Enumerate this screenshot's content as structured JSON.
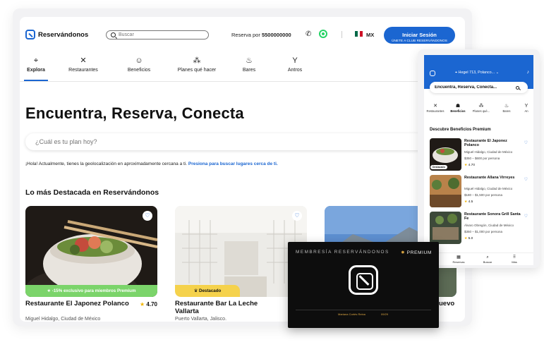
{
  "header": {
    "logo_text": "Reservándonos",
    "search_placeholder": "Buscar",
    "reserve_label": "Reserva por",
    "reserve_phone": "5500000000",
    "country": "MX",
    "login_title": "Iniciar Sesión",
    "login_subtitle": "ÚNETE A CLUB RESERVÁNDONOS"
  },
  "nav": [
    {
      "label": "Explora",
      "icon": "map-pin-icon"
    },
    {
      "label": "Restaurantes",
      "icon": "utensils-icon"
    },
    {
      "label": "Beneficios",
      "icon": "gift-icon"
    },
    {
      "label": "Planes qué hacer",
      "icon": "activities-icon"
    },
    {
      "label": "Bares",
      "icon": "beer-icon"
    },
    {
      "label": "Antros",
      "icon": "cocktail-icon"
    }
  ],
  "hero": {
    "title": "Encuentra, Reserva, Conecta",
    "plan_placeholder": "¿Cuál es tu plan hoy?",
    "geo_text": "¡Hola! Actualmente, tienes la geolocalización en aproximadamente cercana a ti.",
    "geo_link": "Presiona para buscar lugares cerca de ti."
  },
  "featured": {
    "title": "Lo más Destacada en Reservándonos",
    "cards": [
      {
        "tag": "★ -15% exclusivo para miembros Premium",
        "name": "Restaurante El Japonez Polanco",
        "rating": "4.70",
        "address": "Miguel Hidalgo, Ciudad de México"
      },
      {
        "tag": "Destacado",
        "name": "Restaurante Bar La Leche Vallarta",
        "rating": "",
        "address": "Puerto Vallarta, Jalisco."
      },
      {
        "tag": "",
        "name": "uevo",
        "rating": "",
        "address": ""
      }
    ]
  },
  "membership": {
    "title": "MEMBRESÍA RESERVÁNDONOS",
    "tier": "PREMIUM",
    "holder": "Mariana Cortés Reina",
    "expiry": "09/29"
  },
  "mobile": {
    "location": "Hegel 713, Polanco...",
    "search_value": "Encuentra, Reserva, Conecta...",
    "tabs": [
      {
        "label": "Restaurantes",
        "icon": "utensils-icon"
      },
      {
        "label": "Beneficios",
        "icon": "gift-icon"
      },
      {
        "label": "Planes qué...",
        "icon": "activities-icon"
      },
      {
        "label": "Bares",
        "icon": "beer-icon"
      },
      {
        "label": "An",
        "icon": "cocktail-icon"
      }
    ],
    "section_title": "Descubre Beneficios Premium",
    "items": [
      {
        "name": "Restaurante El Japonez Polanco",
        "address": "Miguel Hidalgo, Ciudad de México",
        "price": "$350 – $600 por persona",
        "rating": "4.70",
        "badge": "Destacado"
      },
      {
        "name": "Restaurante Allana Virreyes",
        "address": "Miguel Hidalgo, Ciudad de México",
        "price": "$180 – $1,500 por persona",
        "rating": "4.5",
        "badge": ""
      },
      {
        "name": "Restaurante Sonora Grill Santa Fe",
        "address": "Álvaro Obregón, Ciudad de México",
        "price": "$350 – $1,000 por persona",
        "rating": "5.0",
        "badge": ""
      }
    ],
    "bottom": [
      {
        "label": "Reservas",
        "icon": "calendar-icon"
      },
      {
        "label": "Buscar",
        "icon": "search-icon"
      },
      {
        "label": "Más",
        "icon": "grid-icon"
      }
    ]
  },
  "colors": {
    "brand": "#1b66d1",
    "premium_green": "#7bd46a",
    "featured_yellow": "#f5d24c",
    "gold": "#d9a441"
  }
}
